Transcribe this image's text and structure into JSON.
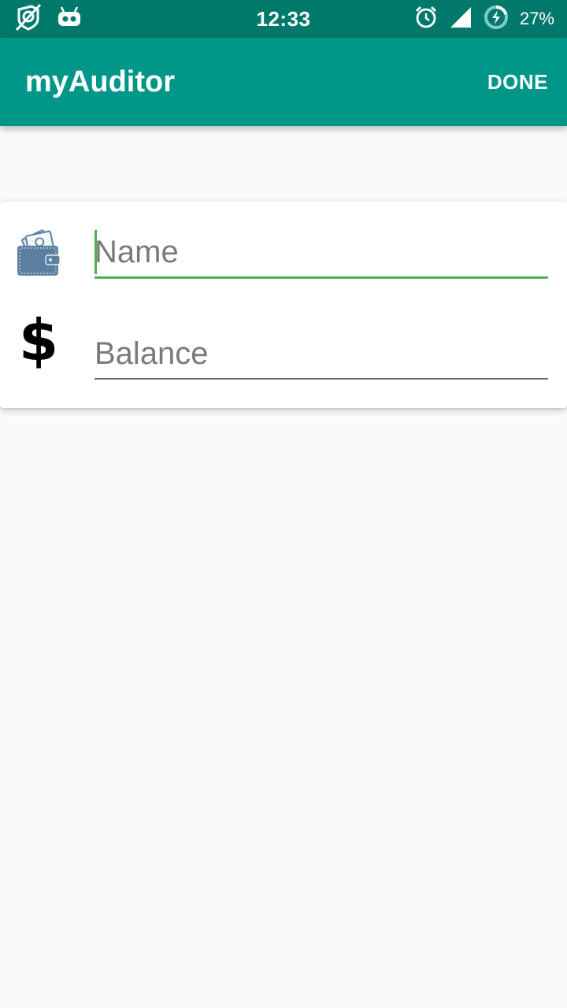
{
  "status_bar": {
    "time": "12:33",
    "battery_percent": "27%",
    "icons": [
      "no-location-icon",
      "robot-icon",
      "alarm-icon",
      "signal-icon",
      "battery-charging-icon"
    ]
  },
  "app_bar": {
    "title": "myAuditor",
    "done_label": "DONE"
  },
  "form": {
    "name_field": {
      "placeholder": "Name",
      "value": "",
      "icon": "wallet-icon"
    },
    "balance_field": {
      "placeholder": "Balance",
      "value": "",
      "icon": "dollar-icon",
      "icon_glyph": "$"
    }
  },
  "colors": {
    "status_bar": "#00796b",
    "app_bar": "#009688",
    "focus_accent": "#4caf50",
    "background": "#fafafa"
  }
}
